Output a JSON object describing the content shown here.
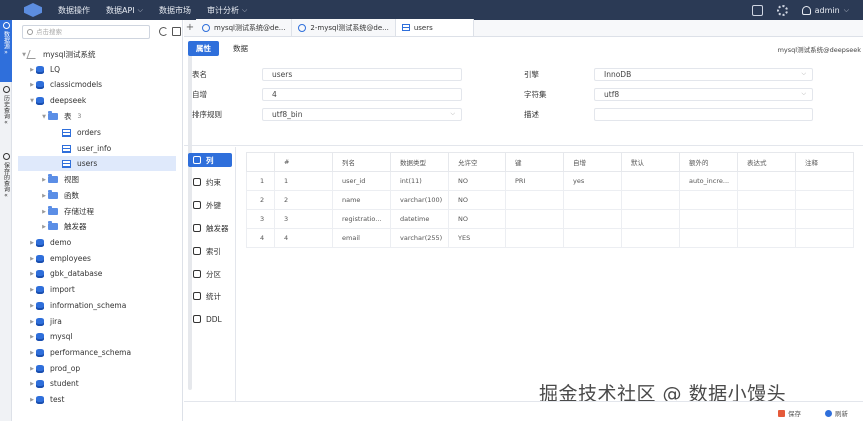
{
  "topbar": {
    "nav": [
      {
        "label": "数据操作",
        "dropdown": false
      },
      {
        "label": "数据API",
        "dropdown": true
      },
      {
        "label": "数据市场",
        "dropdown": false
      },
      {
        "label": "审计分析",
        "dropdown": true
      }
    ],
    "user": "admin"
  },
  "rail": {
    "items": [
      {
        "label": "数据源",
        "chev": "»"
      },
      {
        "label": "历史查询",
        "chev": "«"
      },
      {
        "label": "保存的查询",
        "chev": "«"
      }
    ]
  },
  "sidebar": {
    "search_placeholder": "点击搜索",
    "tree": [
      {
        "label": "mysql测试系统",
        "icon": "connection"
      },
      {
        "label": "LQ",
        "icon": "database"
      },
      {
        "label": "classicmodels",
        "icon": "database"
      },
      {
        "label": "deepseek",
        "icon": "database"
      },
      {
        "label": "表",
        "icon": "folder",
        "count": "3"
      },
      {
        "label": "orders",
        "icon": "table"
      },
      {
        "label": "user_info",
        "icon": "table"
      },
      {
        "label": "users",
        "icon": "table",
        "selected": true
      },
      {
        "label": "视图",
        "icon": "folder"
      },
      {
        "label": "函数",
        "icon": "folder"
      },
      {
        "label": "存储过程",
        "icon": "folder"
      },
      {
        "label": "触发器",
        "icon": "folder"
      },
      {
        "label": "demo",
        "icon": "database"
      },
      {
        "label": "employees",
        "icon": "database"
      },
      {
        "label": "gbk_database",
        "icon": "database"
      },
      {
        "label": "import",
        "icon": "database"
      },
      {
        "label": "information_schema",
        "icon": "database"
      },
      {
        "label": "jira",
        "icon": "database"
      },
      {
        "label": "mysql",
        "icon": "database"
      },
      {
        "label": "performance_schema",
        "icon": "database"
      },
      {
        "label": "prod_op",
        "icon": "database"
      },
      {
        "label": "student",
        "icon": "database"
      },
      {
        "label": "test",
        "icon": "database"
      }
    ]
  },
  "tabs": [
    {
      "label": "mysql测试系统@de...",
      "icon": "query"
    },
    {
      "label": "2-mysql测试系统@de...",
      "icon": "query"
    },
    {
      "label": "users",
      "icon": "table",
      "active": true
    }
  ],
  "subtabs": [
    "属性",
    "数据"
  ],
  "connection_info": "mysql测试系统@deepseek",
  "form": {
    "table_name_label": "表名",
    "table_name": "users",
    "auto_inc_label": "自增",
    "auto_inc": "4",
    "collation_label": "排序规则",
    "collation": "utf8_bin",
    "engine_label": "引擎",
    "engine": "InnoDB",
    "charset_label": "字符集",
    "charset": "utf8",
    "comment_label": "描述",
    "comment": ""
  },
  "section_nav": [
    "列",
    "约束",
    "外键",
    "触发器",
    "索引",
    "分区",
    "统计",
    "DDL"
  ],
  "columns_table": {
    "headers": [
      "",
      "#",
      "列名",
      "数据类型",
      "允许空",
      "键",
      "自增",
      "默认",
      "额外的",
      "表达式",
      "注释"
    ],
    "rows": [
      [
        "1",
        "1",
        "user_id",
        "int(11)",
        "NO",
        "PRI",
        "yes",
        "",
        "auto_incre...",
        "",
        ""
      ],
      [
        "2",
        "2",
        "name",
        "varchar(100)",
        "NO",
        "",
        "",
        "",
        "",
        "",
        ""
      ],
      [
        "3",
        "3",
        "registratio...",
        "datetime",
        "NO",
        "",
        "",
        "",
        "",
        "",
        ""
      ],
      [
        "4",
        "4",
        "email",
        "varchar(255)",
        "YES",
        "",
        "",
        "",
        "",
        "",
        ""
      ]
    ]
  },
  "footer": {
    "save": "保存",
    "refresh": "刷新"
  },
  "watermark": "掘金技术社区 @ 数据小馒头",
  "colors": {
    "accent": "#2f6fdb",
    "topbar": "#2b3a55",
    "save": "#e55a3a",
    "refresh": "#2f6fdb"
  }
}
